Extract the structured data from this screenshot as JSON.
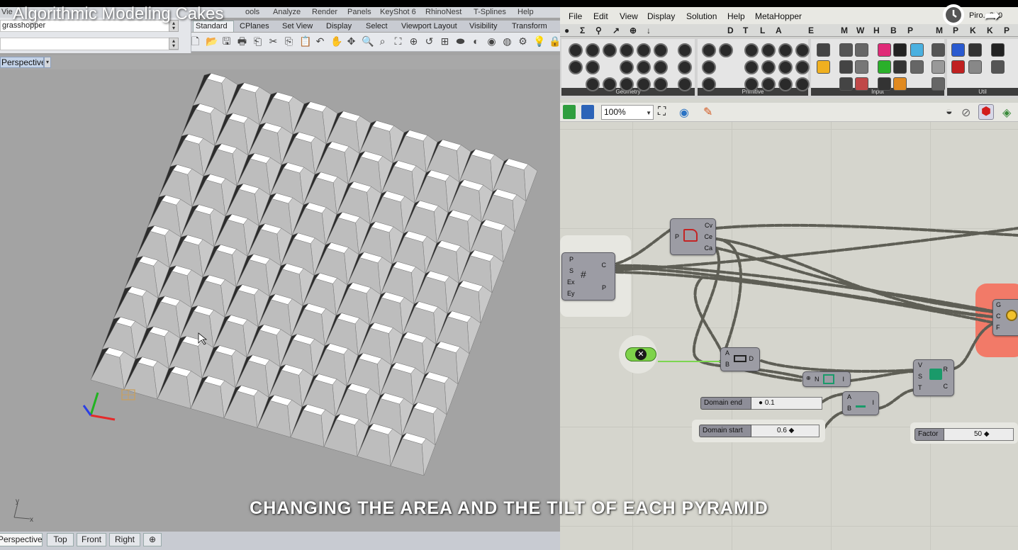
{
  "video": {
    "title": "Algorithmic Modeling Cakes",
    "caption": "CHANGING THE AREA AND THE TILT OF EACH PYRAMID"
  },
  "rhino": {
    "menu": [
      "Vie",
      "ools",
      "Analyze",
      "Render",
      "Panels",
      "KeyShot 6",
      "RhinoNest",
      "T-Splines",
      "Help"
    ],
    "command_value": "grasshopper",
    "toolbar_tabs": [
      "Standard",
      "CPlanes",
      "Set View",
      "Display",
      "Select",
      "Viewport Layout",
      "Visibility",
      "Transform"
    ],
    "viewport_title": "Perspective",
    "viewport_tabs": [
      "Perspective",
      "Top",
      "Front",
      "Right"
    ],
    "viewport_tab_add": "⊕",
    "axis_labels": {
      "y": "y",
      "x": "x"
    },
    "pyramid_grid": {
      "rows": 10,
      "cols": 10
    }
  },
  "grasshopper": {
    "filename": "Piro...2_0",
    "menu": [
      "File",
      "Edit",
      "View",
      "Display",
      "Solution",
      "Help",
      "MetaHopper"
    ],
    "tab_letters": [
      "Σ",
      "⚲",
      "↗",
      "⊕",
      "↓",
      "D",
      "T",
      "L",
      "A",
      "E",
      "M",
      "W",
      "H",
      "B",
      "P",
      "M",
      "P",
      "K",
      "K",
      "P"
    ],
    "palette_groups": [
      "Geometry",
      "Primitive",
      "Input",
      "Util"
    ],
    "zoom": "100%",
    "components": {
      "area": {
        "inputs": [
          "P"
        ],
        "outputs": [
          "Cv",
          "Ce",
          "Ca"
        ]
      },
      "grid": {
        "inputs": [
          "P",
          "S",
          "Ex",
          "Ey"
        ],
        "outputs": [
          "C",
          "P"
        ]
      },
      "pyramid": {
        "inputs": [
          "G",
          "C",
          "F"
        ]
      },
      "bounds": {
        "inputs": [
          "A",
          "B"
        ],
        "outputs": [
          "D"
        ]
      },
      "remap": {
        "inputs": [
          "N"
        ],
        "outputs": [
          "I"
        ]
      },
      "construct_domain": {
        "inputs": [
          "A",
          "B"
        ],
        "outputs": [
          "I"
        ]
      },
      "evaluate": {
        "inputs": [
          "V",
          "S",
          "T"
        ],
        "outputs": [
          "R",
          "C"
        ]
      }
    },
    "sliders": [
      {
        "name": "Domain end",
        "value": "0.1"
      },
      {
        "name": "Domain start",
        "value": "0.6"
      },
      {
        "name": "Factor",
        "value": "50"
      }
    ],
    "colors": {
      "pyramid_group": "#f27a68",
      "toggle": "#7ed34a",
      "wire": "#5e5e55",
      "wire_active": "#7cd650"
    }
  }
}
